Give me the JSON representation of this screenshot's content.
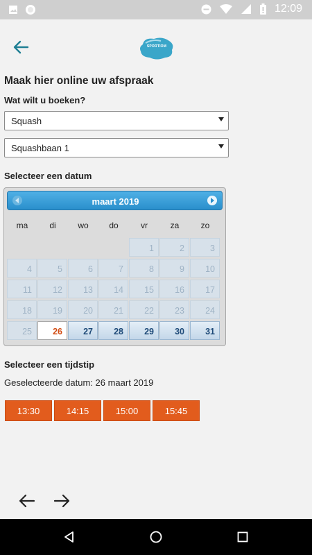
{
  "status_bar": {
    "time": "12:09",
    "icons": [
      "image-icon",
      "circle-icon",
      "do-not-disturb-icon",
      "wifi-icon",
      "signal-icon",
      "battery-icon"
    ]
  },
  "app_bar": {
    "back_icon": "arrow-left-icon",
    "logo_text": "SPORTIOM"
  },
  "form": {
    "heading": "Maak hier online uw afspraak",
    "booking_label": "Wat wilt u boeken?",
    "activity_value": "Squash",
    "court_value": "Squashbaan 1",
    "date_label": "Selecteer een datum"
  },
  "calendar": {
    "month_title": "maart 2019",
    "weekdays": [
      "ma",
      "di",
      "wo",
      "do",
      "vr",
      "za",
      "zo"
    ],
    "weeks": [
      [
        null,
        null,
        null,
        null,
        "1",
        "2",
        "3"
      ],
      [
        "4",
        "5",
        "6",
        "7",
        "8",
        "9",
        "10"
      ],
      [
        "11",
        "12",
        "13",
        "14",
        "15",
        "16",
        "17"
      ],
      [
        "18",
        "19",
        "20",
        "21",
        "22",
        "23",
        "24"
      ],
      [
        "25",
        "26",
        "27",
        "28",
        "29",
        "30",
        "31"
      ]
    ],
    "selected_day": "26",
    "available_days": [
      "27",
      "28",
      "29",
      "30",
      "31"
    ]
  },
  "time_section": {
    "label": "Selecteer een tijdstip",
    "selected_date_text": "Geselecteerde datum: 26 maart 2019",
    "slots": [
      "13:30",
      "14:15",
      "15:00",
      "15:45"
    ]
  },
  "colors": {
    "accent_orange": "#e25c1d",
    "calendar_header_blue": "#2a8fcc",
    "teal_arrow": "#1f7f94"
  }
}
